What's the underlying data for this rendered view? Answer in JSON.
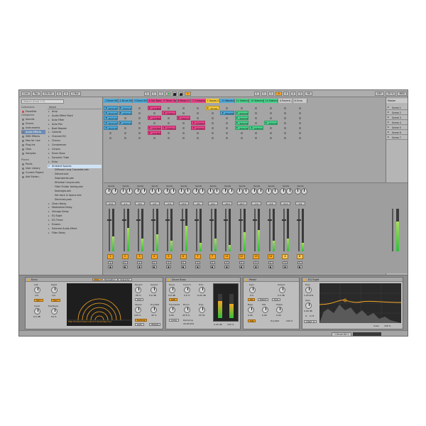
{
  "topbar": {
    "link": "Link",
    "tap": "Tap",
    "tempo": "120.00",
    "sig_num": "4",
    "sig_den": "4",
    "quantize": "1 Bar",
    "position": [
      "2",
      "1",
      "1"
    ],
    "loop_start": [
      "1",
      "1",
      "1"
    ],
    "loop_len": [
      "4",
      "0",
      "0"
    ],
    "zoom": "96",
    "cpu": "25 %",
    "key": "KEY",
    "midi": "MIDI"
  },
  "browser": {
    "search_placeholder": "Search (Cmd + F)",
    "collections_title": "Collections",
    "favorites": "Favorites",
    "categories_title": "Categories",
    "categories": [
      "Sounds",
      "Drums",
      "Instruments",
      "Audio Effects",
      "MIDI Effects",
      "Max for Live",
      "Plug-Ins",
      "Clips",
      "Samples"
    ],
    "places_title": "Places",
    "places": [
      "Packs",
      "User Library",
      "Current Project",
      "Add Folder..."
    ],
    "name_header": "Name",
    "files": [
      {
        "label": "Amp",
        "type": "folder"
      },
      {
        "label": "Audio Effect Rack",
        "type": "folder"
      },
      {
        "label": "Auto Filter",
        "type": "folder"
      },
      {
        "label": "Auto Pan",
        "type": "folder"
      },
      {
        "label": "Beat Repeat",
        "type": "folder"
      },
      {
        "label": "Cabinet",
        "type": "folder"
      },
      {
        "label": "Channel EQ",
        "type": "folder"
      },
      {
        "label": "Chorus",
        "type": "folder"
      },
      {
        "label": "Compressor",
        "type": "folder"
      },
      {
        "label": "Corpus",
        "type": "folder"
      },
      {
        "label": "Drum Buss",
        "type": "folder"
      },
      {
        "label": "Dynamic Tube",
        "type": "folder"
      },
      {
        "label": "Echo",
        "type": "folder"
      },
      {
        "label": "Ambient Spaces",
        "type": "open"
      },
      {
        "label": "Diffused Long Cascades.adv",
        "type": "sub"
      },
      {
        "label": "Distant.adv",
        "type": "sub"
      },
      {
        "label": "Downwards.adv",
        "type": "sub"
      },
      {
        "label": "Ethereal Canyon.adv",
        "type": "sub"
      },
      {
        "label": "Filter Flutter Ambig.adv",
        "type": "sub"
      },
      {
        "label": "Nostalgia.adv",
        "type": "sub"
      },
      {
        "label": "Set back in Space.adv",
        "type": "sub"
      },
      {
        "label": "Shimmery.adv",
        "type": "sub"
      },
      {
        "label": "Clean Delay",
        "type": "folder"
      },
      {
        "label": "Modulated Delay",
        "type": "folder"
      },
      {
        "label": "Vintage Delay",
        "type": "folder"
      },
      {
        "label": "EQ Eight",
        "type": "folder"
      },
      {
        "label": "EQ Three",
        "type": "folder"
      },
      {
        "label": "Erosion",
        "type": "folder"
      },
      {
        "label": "External Audio Effect",
        "type": "folder"
      },
      {
        "label": "Filter Delay",
        "type": "folder"
      }
    ]
  },
  "tracks": [
    {
      "name": "1 Drum Kit",
      "color": "#4fa9d8",
      "num": "1"
    },
    {
      "name": "2 Drum Kit",
      "color": "#4fa9d8",
      "num": "2"
    },
    {
      "name": "3 Drum Kit",
      "color": "#4fa9d8",
      "num": "3"
    },
    {
      "name": "4 Gut Bass Rack",
      "color": "#e8458a",
      "num": "4"
    },
    {
      "name": "5 Three Up Ba",
      "color": "#e8458a",
      "num": "5"
    },
    {
      "name": "6 Deep in Dark",
      "color": "#e8458a",
      "num": "6"
    },
    {
      "name": "7 Crossover B",
      "color": "#e8458a",
      "num": "7"
    },
    {
      "name": "7 Vocals Gr",
      "color": "#f3c83a",
      "num": "7"
    },
    {
      "name": "11 Wavetable",
      "color": "#4fa9d8",
      "num": "11"
    },
    {
      "name": "12 Sidechain Pad",
      "color": "#47d28a",
      "num": "12"
    },
    {
      "name": "13 Sidechain",
      "color": "#47d28a",
      "num": "13"
    },
    {
      "name": "14 Sidechain",
      "color": "#47d28a",
      "num": "14"
    },
    {
      "name": "A Reverb | Compre",
      "color": "#c9c9c9",
      "num": "A"
    },
    {
      "name": "B Echo",
      "color": "#c9c9c9",
      "num": "B"
    }
  ],
  "clips": [
    {
      "label": "Drum Kit 1",
      "track": 0,
      "row": 0,
      "color": "#4fa9d8"
    },
    {
      "label": "Drum Kit 2",
      "track": 0,
      "row": 1,
      "color": "#4fa9d8"
    },
    {
      "label": "Drum Kit 3",
      "track": 0,
      "row": 2,
      "color": "#4fa9d8"
    },
    {
      "label": "Drum Kit 4",
      "track": 0,
      "row": 3,
      "color": "#4fa9d8"
    },
    {
      "label": "Drum Kit 5",
      "track": 0,
      "row": 4,
      "color": "#4fa9d8"
    },
    {
      "label": "Drum Kit 1",
      "track": 1,
      "row": 0,
      "color": "#4fa9d8"
    },
    {
      "label": "Drum Kit 2",
      "track": 1,
      "row": 1,
      "color": "#4fa9d8"
    },
    {
      "label": "Drum Kit 3",
      "track": 1,
      "row": 3,
      "color": "#4fa9d8"
    },
    {
      "label": "Gut Bass Rack",
      "track": 3,
      "row": 0,
      "color": "#e8458a"
    },
    {
      "label": "Gut Bass Rack",
      "track": 3,
      "row": 2,
      "color": "#e8458a"
    },
    {
      "label": "Gut Bass Rack",
      "track": 3,
      "row": 4,
      "color": "#e8458a"
    },
    {
      "label": "Gut Bass Rack",
      "track": 3,
      "row": 5,
      "color": "#e8458a"
    },
    {
      "label": "Three Up Ba",
      "track": 4,
      "row": 1,
      "color": "#e8458a"
    },
    {
      "label": "Three Up Ba",
      "track": 4,
      "row": 4,
      "color": "#e8458a"
    },
    {
      "label": "Deep in Dark",
      "track": 5,
      "row": 2,
      "color": "#e8458a"
    },
    {
      "label": "Crossover B",
      "track": 6,
      "row": 3,
      "color": "#e8458a"
    },
    {
      "label": "Crossover B",
      "track": 6,
      "row": 4,
      "color": "#e8458a"
    },
    {
      "label": "Vocals",
      "track": 7,
      "row": 0,
      "color": "#f3c83a"
    },
    {
      "label": "Wavetable",
      "track": 8,
      "row": 1,
      "color": "#4fa9d8"
    },
    {
      "label": "Sidechain Pad",
      "track": 9,
      "row": 1,
      "color": "#47d28a"
    },
    {
      "label": "Sidechain Pad",
      "track": 9,
      "row": 2,
      "color": "#47d28a"
    },
    {
      "label": "Sidechain Pad",
      "track": 9,
      "row": 3,
      "color": "#47d28a"
    },
    {
      "label": "Sidechain Pad",
      "track": 9,
      "row": 4,
      "color": "#47d28a"
    },
    {
      "label": "Sidechain",
      "track": 10,
      "row": 4,
      "color": "#47d28a"
    },
    {
      "label": "Sidechain",
      "track": 11,
      "row": 3,
      "color": "#47d28a"
    }
  ],
  "master": {
    "name": "Master",
    "num": "Master"
  },
  "scenes": [
    "Scene 1",
    "Scene 2",
    "Scene 3",
    "Scene 4",
    "Scene 5",
    "Scene 6",
    "Scene 7"
  ],
  "mixer": {
    "sends_label": "Sends",
    "db_values": [
      "-13.1",
      "-1.1",
      "-8.1",
      "-0.3",
      "-2.0",
      "-13.0",
      "-10",
      "-0.4",
      "-10.3",
      "-16.7",
      "-1.1",
      "-1.8",
      "-11.1",
      "-3.0"
    ],
    "meter_levels": [
      0.35,
      0.55,
      0.3,
      0.4,
      0.25,
      0.6,
      0.2,
      0.3,
      0.15,
      0.45,
      0.5,
      0.25,
      0.3,
      0.2
    ],
    "master_level": 0.7
  },
  "devices": {
    "echo": {
      "title": "Echo",
      "tabs": [
        "Echo",
        "Modulation",
        "Character"
      ],
      "left_label": "Left",
      "right_label": "Right",
      "left_val": "1/4",
      "right_val": "1/4",
      "sync_label": "Sync",
      "feedback_label": "Feedback",
      "feedback_val": "54 %",
      "input_label": "Input",
      "input_val": "0.0 dB",
      "filter_text": "Filter  HP 252 Hz  Res 0.18  LP 5.39 kHz  Res 0.11",
      "reverb_label": "Reverb",
      "reverb_val": "-38 %",
      "stereo_label": "Stereo",
      "stereo_val": "100 %",
      "output_label": "Output",
      "output_val": "0.0 dB",
      "dry_wet_label": "Dry/Wet",
      "dry_wet_val": "40 %",
      "ducking_label": "Ducking",
      "gate_label": "Gate",
      "mode_label": "Post",
      "wobble_label": "Wobble"
    },
    "drum_buss": {
      "title": "Drum Buss",
      "drive_label": "Drive",
      "drive_val": "0.0 dB",
      "crunch_label": "Crunch",
      "crunch_val": "0.0 %",
      "boom_label": "Boom",
      "boom_val": "45.6 %",
      "freq_label": "Freq",
      "freq_val": "55 Hz",
      "soft_label": "Soft",
      "transients_label": "Transients",
      "transients_val": "0.00",
      "trim_label": "Trim",
      "trim_val": "-0.00 dB",
      "output_label": "Output",
      "output_val": "0.00 dB",
      "comp_label": "Comp",
      "dry_wet_label": "Dry/Wet",
      "dry_wet_val": "100 %",
      "damping_label": "Damping",
      "damping_val": "20.00 kHz"
    },
    "pedal": {
      "title": "Pedal",
      "gain_label": "Gain",
      "gain_val": "0.0",
      "output_label": "Output",
      "output_val": "0.0 dB",
      "modes": [
        "OD",
        "Distort",
        "Fuzz"
      ],
      "bass_label": "Bass",
      "bass_val": "0.00",
      "mid_label": "Mid",
      "mid_val": "0.00",
      "treble_label": "Treble",
      "treble_val": "0.00",
      "sub_label": "Sub",
      "dry_wet_label": "Dry/Wet",
      "dry_wet_val": "100 %"
    },
    "eq_eight": {
      "title": "EQ Eight",
      "freq_label": "Freq",
      "freq_val": "1.25 kHz",
      "gain_label": "Gain",
      "gain_val": "0.00 dB",
      "q_label": "Q",
      "q_val": "0.71",
      "scale_label": "Scale",
      "scale_val": "100 %",
      "adapt_label": "Adapt. Q"
    }
  },
  "statusbar": {
    "track_name": "1 Drum Kit 1"
  },
  "colors": {
    "accent": "#f5a623",
    "play": "#2aa830",
    "blue": "#4fa9d8",
    "pink": "#e8458a",
    "green": "#47d28a",
    "yellow": "#f3c83a"
  }
}
